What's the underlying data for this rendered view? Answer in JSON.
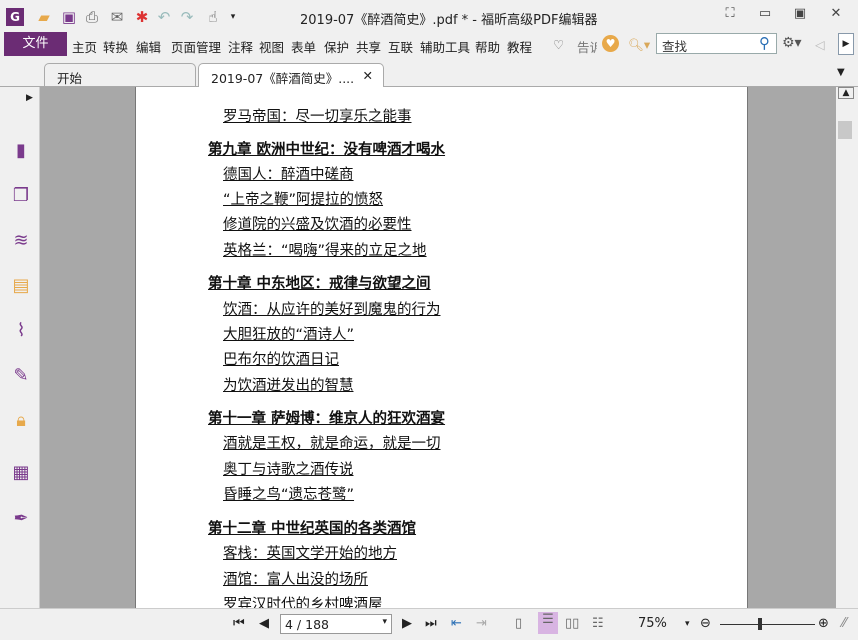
{
  "window": {
    "title": "2019-07《醉酒简史》.pdf * - 福昕高级PDF编辑器"
  },
  "quick_access": [
    "app-logo-icon",
    "open-icon",
    "save-icon",
    "print-icon",
    "email-icon",
    "new-icon",
    "undo-icon",
    "redo-icon",
    "hand-tool-icon"
  ],
  "menu": {
    "file": "文件",
    "items": [
      "主页",
      "转换",
      "编辑",
      "页面管理",
      "注释",
      "视图",
      "表单",
      "保护",
      "共享",
      "互联",
      "辅助工具",
      "帮助",
      "教程"
    ],
    "tell_me": "告诉",
    "search_placeholder": "查找"
  },
  "tabs": [
    {
      "label": "开始"
    },
    {
      "label": "2019-07《醉酒简史》...."
    }
  ],
  "sidebar_icons": [
    "pages-icon",
    "thumbnails-icon",
    "layers-icon",
    "comments-icon",
    "attachments-icon",
    "signatures-icon",
    "security-icon",
    "form-fields-icon",
    "sign-pen-icon"
  ],
  "document": {
    "lines": [
      {
        "type": "section",
        "text": "罗马帝国：尽一切享乐之能事"
      },
      {
        "type": "chapter",
        "text": "第九章 欧洲中世纪：没有啤酒才喝水"
      },
      {
        "type": "section",
        "text": "德国人：醉酒中磋商"
      },
      {
        "type": "section",
        "text": "“上帝之鞭”阿提拉的愤怒"
      },
      {
        "type": "section",
        "text": "修道院的兴盛及饮酒的必要性"
      },
      {
        "type": "section",
        "text": "英格兰：“喝嗨”得来的立足之地"
      },
      {
        "type": "chapter",
        "text": "第十章 中东地区：戒律与欲望之间"
      },
      {
        "type": "section",
        "text": "饮酒：从应许的美好到魔鬼的行为"
      },
      {
        "type": "section",
        "text": "大胆狂放的“酒诗人”"
      },
      {
        "type": "section",
        "text": "巴布尔的饮酒日记"
      },
      {
        "type": "section",
        "text": "为饮酒迸发出的智慧"
      },
      {
        "type": "chapter",
        "text": "第十一章 萨姆博：维京人的狂欢酒宴"
      },
      {
        "type": "section",
        "text": "酒就是王权，就是命运，就是一切"
      },
      {
        "type": "section",
        "text": "奥丁与诗歌之酒传说"
      },
      {
        "type": "section",
        "text": "昏睡之鸟“遗忘苍鹭”"
      },
      {
        "type": "chapter",
        "text": "第十二章 中世纪英国的各类酒馆"
      },
      {
        "type": "section",
        "text": "客栈：英国文学开始的地方"
      },
      {
        "type": "section",
        "text": "酒馆：富人出没的场所"
      },
      {
        "type": "section",
        "text": "罗宾汉时代的乡村啤酒屋"
      }
    ]
  },
  "status": {
    "page": "4 / 188",
    "zoom": "75%",
    "zoom_slider_percent": 40
  },
  "colors": {
    "accent": "#6b2c74",
    "active_view": "#d8b4e2"
  }
}
